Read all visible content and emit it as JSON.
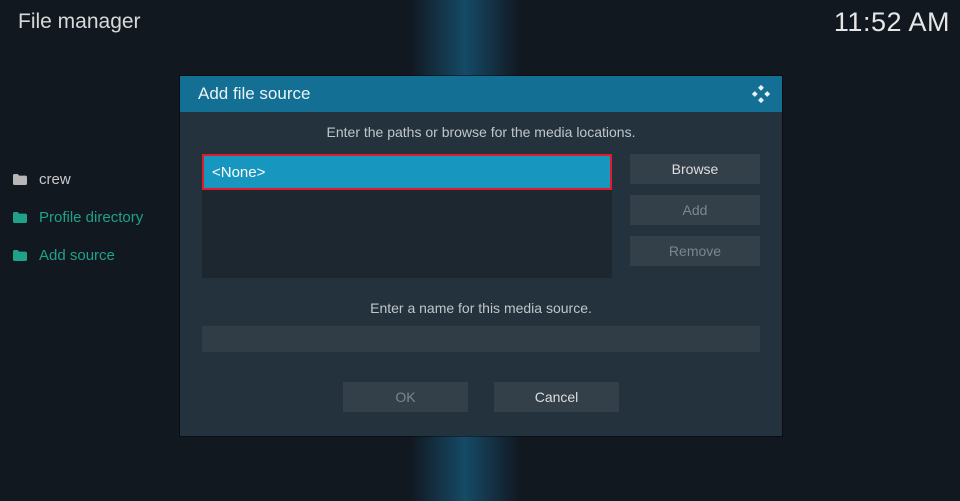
{
  "header": {
    "title": "File manager",
    "clock": "11:52 AM"
  },
  "sidebar": {
    "items": [
      {
        "label": "crew",
        "style": "norm"
      },
      {
        "label": "Profile directory",
        "style": "hl"
      },
      {
        "label": "Add source",
        "style": "hl"
      }
    ]
  },
  "dialog": {
    "title": "Add file source",
    "instruction_paths": "Enter the paths or browse for the media locations.",
    "path_value": "<None>",
    "buttons": {
      "browse": "Browse",
      "add": "Add",
      "remove": "Remove"
    },
    "instruction_name": "Enter a name for this media source.",
    "name_value": "",
    "ok": "OK",
    "cancel": "Cancel"
  }
}
